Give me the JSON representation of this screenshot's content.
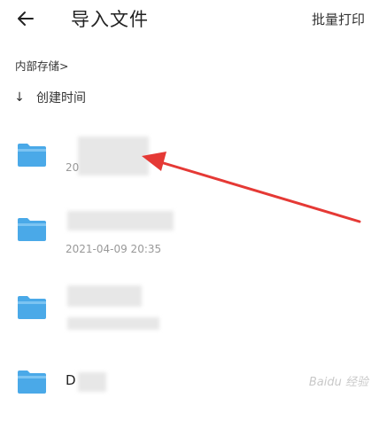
{
  "header": {
    "back_icon": "arrow-left-icon",
    "title": "导入文件",
    "batch_print": "批量打印"
  },
  "path": {
    "label": "内部存储>"
  },
  "sort": {
    "arrow_icon": "arrow-down-icon",
    "label": "创建时间"
  },
  "files": [
    {
      "name": "",
      "date": "20",
      "icon": "folder-icon"
    },
    {
      "name": "",
      "date": "2021-04-09 20:35",
      "icon": "folder-icon"
    },
    {
      "name": "",
      "date": "",
      "icon": "folder-icon"
    },
    {
      "name": "D",
      "date": "",
      "icon": "folder-icon"
    }
  ],
  "colors": {
    "folder_blue": "#4aa9e8",
    "folder_tab": "#7cc4f2",
    "annotation_red": "#e53935"
  },
  "watermark": {
    "text": "Baidu 经验"
  }
}
